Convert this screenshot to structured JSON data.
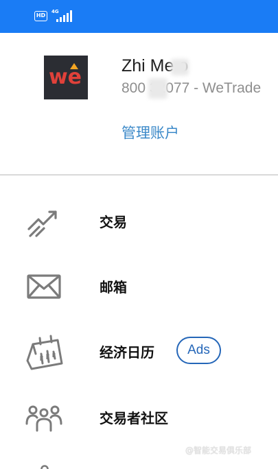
{
  "status_bar": {
    "hd": "HD",
    "network": "4G"
  },
  "account": {
    "logo_text": "we",
    "name": "Zhi Me   o",
    "number": "800 32077 - WeTrade",
    "manage_link": "管理账户"
  },
  "menu": [
    {
      "label": "交易",
      "icon": "trading-chart-icon"
    },
    {
      "label": "邮箱",
      "icon": "mail-icon"
    },
    {
      "label": "经济日历",
      "icon": "calendar-icon",
      "badge": "Ads"
    },
    {
      "label": "交易者社区",
      "icon": "community-icon"
    }
  ],
  "watermark": "@智能交易俱乐部",
  "colors": {
    "status_bar": "#1a7cf5",
    "link": "#3a88c8",
    "ads_badge": "#2466b8",
    "logo_background": "#2b2d33",
    "logo_red": "#e0413a",
    "logo_orange": "#f5a623",
    "icon_gray": "#7b7b7b"
  }
}
